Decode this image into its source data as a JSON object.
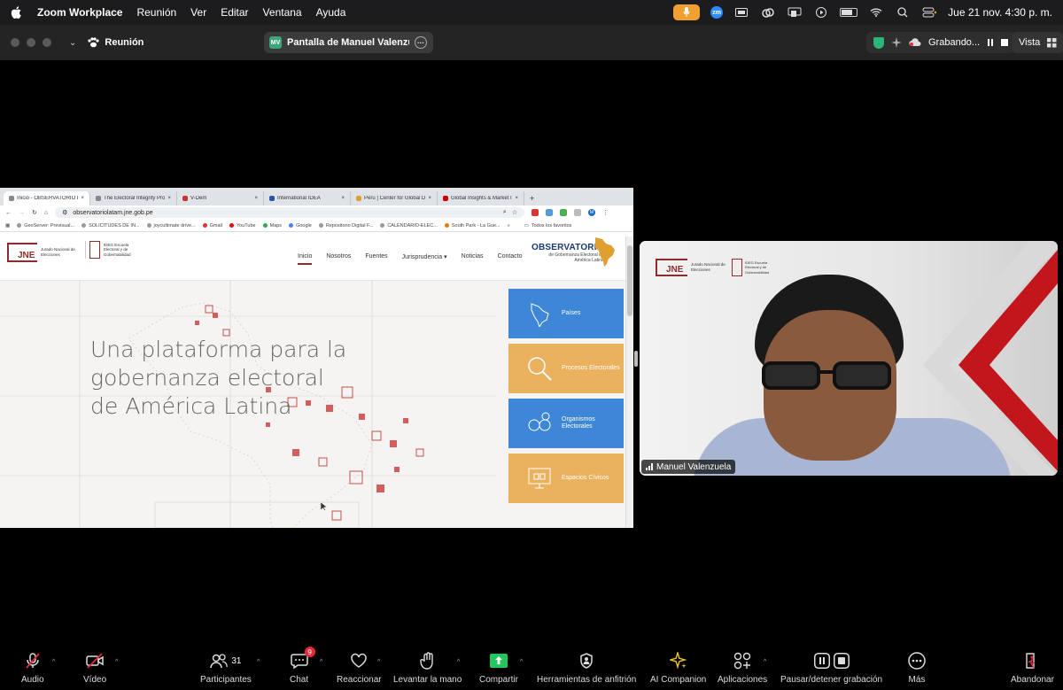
{
  "menubar": {
    "app_name": "Zoom Workplace",
    "menus": [
      "Reunión",
      "Ver",
      "Editar",
      "Ventana",
      "Ayuda"
    ],
    "datetime": "Jue 21 nov.  4:30 p. m.",
    "zm_badge": "zm"
  },
  "zoombar": {
    "meeting_label": "Reunión",
    "share_label": "Pantalla de Manuel Valenzuela",
    "share_initials": "MV",
    "recording_label": "Grabando...",
    "view_label": "Vista"
  },
  "browser": {
    "tabs": [
      {
        "title": "Inicio - OBSERVATORIO LATAM",
        "active": true
      },
      {
        "title": "The Electoral Integrity Project",
        "active": false
      },
      {
        "title": "V-Dem",
        "active": false
      },
      {
        "title": "International IDEA",
        "active": false
      },
      {
        "title": "Peru | Center for Global Development",
        "active": false
      },
      {
        "title": "Global Insights & Market Intelligence",
        "active": false
      }
    ],
    "new_tab": "+",
    "url": "observatoriolatam.jne.gob.pe",
    "bookmarks": [
      "GeoServer: Previsual...",
      "SOLICITUDES DE IN...",
      "joycultimate drive...",
      "Gmail",
      "YouTube",
      "Maps",
      "Google",
      "Repositorio Digital F...",
      "CALENDARIO-ELEC...",
      "South Park - La Gue..."
    ],
    "bookmarks_more": "»",
    "all_bookmarks": "Todos los favoritos",
    "profile_initial": "M"
  },
  "site": {
    "jne_logo": "JNE",
    "jne_text": "Jurado Nacional de Elecciones",
    "ideg_text": "IDEG Escuela Electoral y de Gobernabilidad",
    "nav": [
      "Inicio",
      "Nosotros",
      "Fuentes",
      "Jurisprudencia",
      "Noticias",
      "Contacto"
    ],
    "nav_dropdown_marker": "▾",
    "obs_title": "OBSERVATORIO",
    "obs_sub1": "de Gobernanza Electoral de",
    "obs_sub2": "América Latina",
    "hero_title": "Una plataforma para la gobernanza electoral de América Latina",
    "tiles": [
      {
        "label": "Países",
        "color": "blue"
      },
      {
        "label": "Procesos Electorales",
        "color": "gold"
      },
      {
        "label": "Organismos Electorales",
        "color": "blue"
      },
      {
        "label": "Espacios Cívicos",
        "color": "gold"
      }
    ]
  },
  "video": {
    "participant_name": "Manuel Valenzuela",
    "jne_logo": "JNE",
    "jne_text": "Jurado Nacional de Elecciones",
    "ideg_text": "IDEG Escuela Electoral y de Gobernabilidad"
  },
  "toolbar": {
    "items": [
      {
        "label": "Audio"
      },
      {
        "label": "Vídeo"
      },
      {
        "label": "Participantes",
        "count": "31"
      },
      {
        "label": "Chat",
        "badge": "9"
      },
      {
        "label": "Reaccionar"
      },
      {
        "label": "Levantar la mano"
      },
      {
        "label": "Compartir"
      },
      {
        "label": "Herramientas de anfitrión"
      },
      {
        "label": "AI Companion"
      },
      {
        "label": "Aplicaciones"
      },
      {
        "label": "Pausar/detener grabación"
      },
      {
        "label": "Más"
      },
      {
        "label": "Abandonar"
      }
    ]
  },
  "colors": {
    "accent_red": "#8f2b2b",
    "tile_blue": "#3e86d6",
    "tile_gold": "#eab15e",
    "mic_pill": "#f0a030",
    "share_green": "#2bb673",
    "badge_red": "#e8283a"
  }
}
